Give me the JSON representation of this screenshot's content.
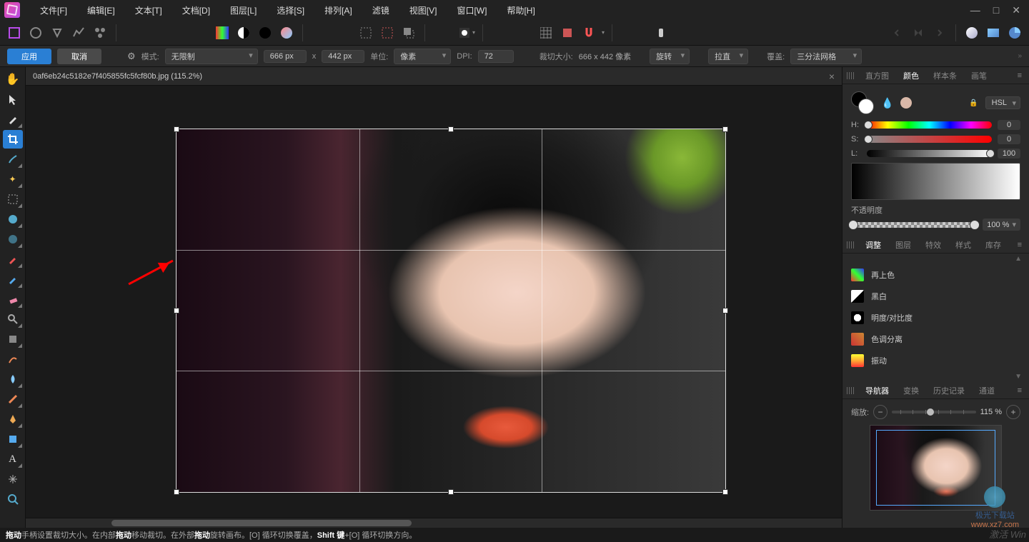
{
  "menu": [
    "文件[F]",
    "编辑[E]",
    "文本[T]",
    "文档[D]",
    "图层[L]",
    "选择[S]",
    "排列[A]",
    "滤镜",
    "视图[V]",
    "窗口[W]",
    "帮助[H]"
  ],
  "options": {
    "apply": "应用",
    "cancel": "取消",
    "mode_label": "模式:",
    "mode_value": "无限制",
    "width": "666 px",
    "x_sep": "x",
    "height": "442 px",
    "unit_label": "单位:",
    "unit_value": "像素",
    "dpi_label": "DPI:",
    "dpi_value": "72",
    "crop_label": "裁切大小:",
    "crop_value": "666 x 442 像素",
    "rotate": "旋转",
    "straighten": "拉直",
    "overlay_label": "覆盖:",
    "overlay_value": "三分法网格"
  },
  "doc": {
    "title": "0af6eb24c5182e7f405855fc5fcf80b.jpg (115.2%)"
  },
  "panels": {
    "color_tabs": [
      "直方图",
      "颜色",
      "样本条",
      "画笔"
    ],
    "color_tabs_active": 1,
    "color_model": "HSL",
    "H_label": "H:",
    "H_val": "0",
    "S_label": "S:",
    "S_val": "0",
    "L_label": "L:",
    "L_val": "100",
    "opacity_label": "不透明度",
    "opacity_val": "100 %",
    "adjust_tabs": [
      "调整",
      "图层",
      "特效",
      "样式",
      "库存"
    ],
    "adjust_tabs_active": 0,
    "adjustments": [
      {
        "name": "再上色",
        "bg": "linear-gradient(45deg,#f33,#3f3,#33f)"
      },
      {
        "name": "黑白",
        "bg": "linear-gradient(135deg,#fff 0 50%,#000 50%)"
      },
      {
        "name": "明度/对比度",
        "bg": "radial-gradient(circle,#fff 0 40%,#000 40%)"
      },
      {
        "name": "色调分离",
        "bg": "linear-gradient(45deg,#c33,#c83)"
      },
      {
        "name": "振动",
        "bg": "linear-gradient(0deg,#f33,#fa3,#ff3)"
      }
    ],
    "nav_tabs": [
      "导航器",
      "变换",
      "历史记录",
      "通道"
    ],
    "nav_tabs_active": 0,
    "zoom_label": "缩放:",
    "zoom_val": "115 %"
  },
  "status": {
    "drag1": "拖动",
    "t1": " 手柄设置裁切大小。在内部 ",
    "drag2": "拖动",
    "t2": " 移动裁切。在外部 ",
    "drag3": "拖动",
    "t3": " 旋转画布。[O] 循环切换覆盖，",
    "shift": "Shift 键",
    "t4": "+[O] 循环切换方向。"
  },
  "watermark": {
    "site": "极光下载站",
    "url": "www.xz7.com"
  },
  "activate": "激活 Win"
}
